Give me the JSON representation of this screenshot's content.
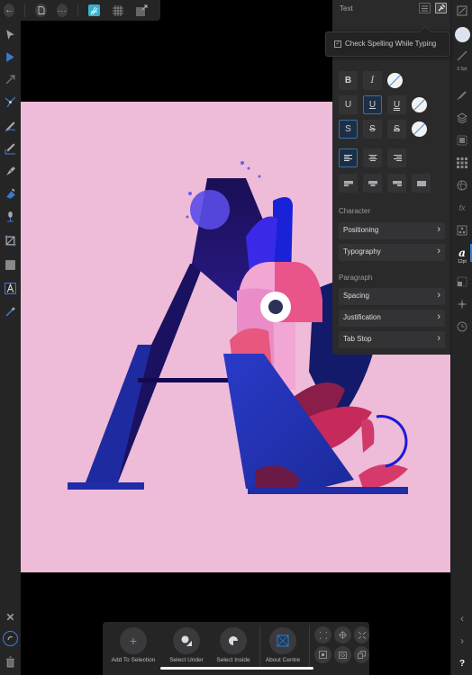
{
  "topbar": {
    "back_icon": "arrow-left-icon",
    "document_icon": "document-icon",
    "more_icon": "ellipsis-icon",
    "persona_icon": "designer-persona-icon",
    "grid_icon": "grid-icon",
    "export_icon": "export-persona-icon"
  },
  "left_tools": [
    {
      "name": "move-tool",
      "icon": "pointer-icon"
    },
    {
      "name": "node-tool",
      "icon": "node-pointer-icon"
    },
    {
      "name": "corner-tool",
      "icon": "corner-icon"
    },
    {
      "name": "point-transform-tool",
      "icon": "point-transform-icon"
    },
    {
      "name": "pencil-tool",
      "icon": "pencil-icon"
    },
    {
      "name": "vector-brush-tool",
      "icon": "vector-brush-icon"
    },
    {
      "name": "pen-tool",
      "icon": "pen-icon"
    },
    {
      "name": "fill-tool",
      "icon": "fill-icon"
    },
    {
      "name": "transparency-tool",
      "icon": "transparency-icon"
    },
    {
      "name": "crop-tool",
      "icon": "crop-icon"
    },
    {
      "name": "rectangle-tool",
      "icon": "rectangle-icon"
    },
    {
      "name": "artistic-text-tool",
      "icon": "text-tool-icon"
    },
    {
      "name": "color-picker-tool",
      "icon": "eyedropper-icon"
    }
  ],
  "left_bottom": {
    "close_icon": "close-icon",
    "snapping_icon": "magnet-icon",
    "delete_icon": "trash-icon"
  },
  "right_studio": {
    "stroke_width": "0.5pt",
    "font_size": "12pt",
    "help_label": "?",
    "items": [
      "transform-icon",
      "color-icon",
      "stroke-icon",
      "brushes-icon",
      "layers-icon",
      "effects-icon",
      "swatches-icon",
      "styles-icon",
      "fx-icon",
      "appearance-icon",
      "text-studio-icon",
      "navigator-icon",
      "snapping-icon",
      "history-icon"
    ]
  },
  "text_panel": {
    "title": "Text",
    "list_icon": "list-icon",
    "pin_icon": "pin-icon",
    "bold": "B",
    "italic": "I",
    "underline_labels": [
      "U",
      "U",
      "U"
    ],
    "strike_labels": [
      "S",
      "S",
      "S"
    ],
    "sections": {
      "character": "Character",
      "paragraph": "Paragraph"
    },
    "character_items": [
      "Positioning",
      "Typography"
    ],
    "paragraph_items": [
      "Spacing",
      "Justification",
      "Tab Stop"
    ],
    "chevron": "›",
    "accent_color": "#3b6ea5"
  },
  "popover": {
    "checkbox_checked": true,
    "checkbox_mark": "✓",
    "label": "Check Spelling While Typing"
  },
  "context_toolbar": {
    "buttons": [
      {
        "label": "Add To Selection",
        "icon": "plus-icon"
      },
      {
        "label": "Select Under",
        "icon": "select-under-icon"
      },
      {
        "label": "Select Inside",
        "icon": "select-inside-icon"
      },
      {
        "label": "About Centre",
        "icon": "about-centre-icon"
      }
    ],
    "small_buttons": [
      "transform-origin-icon",
      "crosshair-icon",
      "fit-icon",
      "bounding-box-icon",
      "eye-icon",
      "duplicate-icon"
    ]
  },
  "canvas": {
    "background": "#eebbd9",
    "artwork": "Letter A illustration with parrot"
  }
}
